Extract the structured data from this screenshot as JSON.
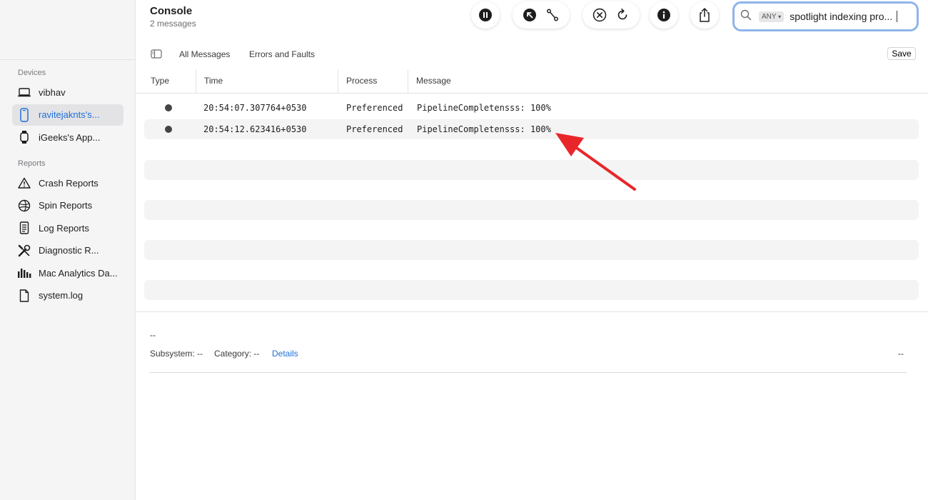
{
  "header": {
    "title": "Console",
    "subtitle": "2 messages"
  },
  "search": {
    "scope": "ANY",
    "query": "spotlight indexing pro..."
  },
  "filters": {
    "all_messages": "All Messages",
    "errors_and_faults": "Errors and Faults",
    "save": "Save"
  },
  "sidebar": {
    "devices_label": "Devices",
    "devices": [
      {
        "label": "vibhav",
        "icon": "laptop-icon"
      },
      {
        "label": "ravitejaknts's...",
        "icon": "iphone-icon",
        "selected": true
      },
      {
        "label": "iGeeks's App...",
        "icon": "watch-icon"
      }
    ],
    "reports_label": "Reports",
    "reports": [
      {
        "label": "Crash Reports",
        "icon": "warning-triangle-icon"
      },
      {
        "label": "Spin Reports",
        "icon": "spin-icon"
      },
      {
        "label": "Log Reports",
        "icon": "log-document-icon"
      },
      {
        "label": "Diagnostic R...",
        "icon": "tools-icon"
      },
      {
        "label": "Mac Analytics Da...",
        "icon": "bar-chart-icon"
      },
      {
        "label": "system.log",
        "icon": "file-icon"
      }
    ]
  },
  "table": {
    "columns": {
      "type": "Type",
      "time": "Time",
      "process": "Process",
      "message": "Message"
    },
    "rows": [
      {
        "time": "20:54:07.307764+0530",
        "process": "Preferenced",
        "message": "PipelineCompletensss: 100%"
      },
      {
        "time": "20:54:12.623416+0530",
        "process": "Preferenced",
        "message": "PipelineCompletensss: 100%"
      }
    ]
  },
  "detail": {
    "placeholder": "--",
    "subsystem": "Subsystem: --",
    "category": "Category: --",
    "details_link": "Details",
    "right_value": "--"
  },
  "colors": {
    "accent": "#1e6fd9",
    "annotation_arrow": "#e8262a"
  }
}
